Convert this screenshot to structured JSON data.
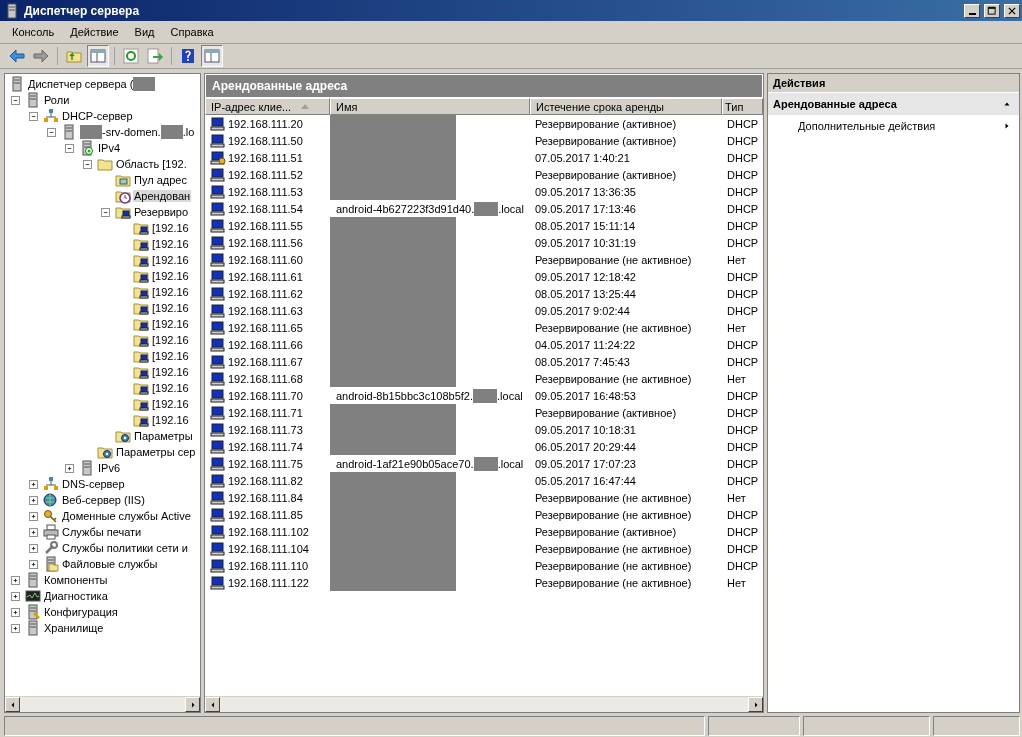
{
  "window": {
    "title": "Диспетчер сервера"
  },
  "menu": [
    "Консоль",
    "Действие",
    "Вид",
    "Справка"
  ],
  "toolbar": [
    {
      "kind": "back"
    },
    {
      "kind": "forward"
    },
    {
      "kind": "sep"
    },
    {
      "kind": "up"
    },
    {
      "kind": "tree",
      "selected": true
    },
    {
      "kind": "sep"
    },
    {
      "kind": "refresh"
    },
    {
      "kind": "export"
    },
    {
      "kind": "sep"
    },
    {
      "kind": "help"
    },
    {
      "kind": "actions",
      "selected": true
    }
  ],
  "tree": [
    {
      "kind": "server-manager",
      "parts": [
        {
          "text": "Диспетчер сервера ("
        },
        {
          "kind": "redacted"
        }
      ],
      "selected": false,
      "children": [
        {
          "kind": "roles",
          "parts": [
            {
              "text": "Роли"
            }
          ],
          "expanded": true,
          "selected": false,
          "children": [
            {
              "kind": "dhcp",
              "parts": [
                {
                  "text": "DHCP-сервер"
                }
              ],
              "expanded": true,
              "selected": false,
              "children": [
                {
                  "kind": "server",
                  "parts": [
                    {
                      "kind": "redacted"
                    },
                    {
                      "text": "-srv-domen."
                    },
                    {
                      "kind": "redacted"
                    },
                    {
                      "text": ".lo"
                    }
                  ],
                  "expanded": true,
                  "selected": false,
                  "children": [
                    {
                      "kind": "ipv4",
                      "parts": [
                        {
                          "text": "IPv4"
                        }
                      ],
                      "expanded": true,
                      "selected": false,
                      "children": [
                        {
                          "kind": "folder",
                          "parts": [
                            {
                              "text": "Область [192."
                            }
                          ],
                          "expanded": true,
                          "selected": false,
                          "children": [
                            {
                              "kind": "pool",
                              "parts": [
                                {
                                  "text": "Пул адрес"
                                }
                              ],
                              "selected": false
                            },
                            {
                              "kind": "lease",
                              "parts": [
                                {
                                  "text": "Арендован"
                                }
                              ],
                              "selected": true
                            },
                            {
                              "kind": "reservations",
                              "parts": [
                                {
                                  "text": "Резервиро"
                                }
                              ],
                              "expanded": true,
                              "selected": false,
                              "children": [
                                {
                                  "kind": "reservation",
                                  "parts": [
                                    {
                                      "text": "[192.16"
                                    }
                                  ],
                                  "selected": false
                                },
                                {
                                  "kind": "reservation",
                                  "parts": [
                                    {
                                      "text": "[192.16"
                                    }
                                  ],
                                  "selected": false
                                },
                                {
                                  "kind": "reservation",
                                  "parts": [
                                    {
                                      "text": "[192.16"
                                    }
                                  ],
                                  "selected": false
                                },
                                {
                                  "kind": "reservation",
                                  "parts": [
                                    {
                                      "text": "[192.16"
                                    }
                                  ],
                                  "selected": false
                                },
                                {
                                  "kind": "reservation",
                                  "parts": [
                                    {
                                      "text": "[192.16"
                                    }
                                  ],
                                  "selected": false
                                },
                                {
                                  "kind": "reservation",
                                  "parts": [
                                    {
                                      "text": "[192.16"
                                    }
                                  ],
                                  "selected": false
                                },
                                {
                                  "kind": "reservation",
                                  "parts": [
                                    {
                                      "text": "[192.16"
                                    }
                                  ],
                                  "selected": false
                                },
                                {
                                  "kind": "reservation",
                                  "parts": [
                                    {
                                      "text": "[192.16"
                                    }
                                  ],
                                  "selected": false
                                },
                                {
                                  "kind": "reservation",
                                  "parts": [
                                    {
                                      "text": "[192.16"
                                    }
                                  ],
                                  "selected": false
                                },
                                {
                                  "kind": "reservation",
                                  "parts": [
                                    {
                                      "text": "[192.16"
                                    }
                                  ],
                                  "selected": false
                                },
                                {
                                  "kind": "reservation",
                                  "parts": [
                                    {
                                      "text": "[192.16"
                                    }
                                  ],
                                  "selected": false
                                },
                                {
                                  "kind": "reservation",
                                  "parts": [
                                    {
                                      "text": "[192.16"
                                    }
                                  ],
                                  "selected": false
                                },
                                {
                                  "kind": "reservation",
                                  "parts": [
                                    {
                                      "text": "[192.16"
                                    }
                                  ],
                                  "selected": false
                                }
                              ]
                            },
                            {
                              "kind": "options",
                              "parts": [
                                {
                                  "text": "Параметры"
                                }
                              ],
                              "selected": false
                            }
                          ]
                        },
                        {
                          "kind": "options-folder",
                          "parts": [
                            {
                              "text": "Параметры сер"
                            }
                          ],
                          "selected": false
                        }
                      ]
                    },
                    {
                      "kind": "ipv6",
                      "parts": [
                        {
                          "text": "IPv6"
                        }
                      ],
                      "expanded": false,
                      "selected": false
                    }
                  ]
                }
              ]
            },
            {
              "kind": "dns",
              "parts": [
                {
                  "text": "DNS-сервер"
                }
              ],
              "expanded": false,
              "selected": false
            },
            {
              "kind": "web",
              "parts": [
                {
                  "text": "Веб-сервер (IIS)"
                }
              ],
              "expanded": false,
              "selected": false
            },
            {
              "kind": "ad",
              "parts": [
                {
                  "text": "Доменные службы Active"
                }
              ],
              "expanded": false,
              "selected": false
            },
            {
              "kind": "print",
              "parts": [
                {
                  "text": "Службы печати"
                }
              ],
              "expanded": false,
              "selected": false
            },
            {
              "kind": "nps",
              "parts": [
                {
                  "text": "Службы политики сети и"
                }
              ],
              "expanded": false,
              "selected": false
            },
            {
              "kind": "files",
              "parts": [
                {
                  "text": "Файловые службы"
                }
              ],
              "expanded": false,
              "selected": false
            }
          ]
        },
        {
          "kind": "features",
          "parts": [
            {
              "text": "Компоненты"
            }
          ],
          "expanded": false,
          "selected": false
        },
        {
          "kind": "diagnostics",
          "parts": [
            {
              "text": "Диагностика"
            }
          ],
          "expanded": false,
          "selected": false
        },
        {
          "kind": "config",
          "parts": [
            {
              "text": "Конфигурация"
            }
          ],
          "expanded": false,
          "selected": false
        },
        {
          "kind": "storage",
          "parts": [
            {
              "text": "Хранилище"
            }
          ],
          "expanded": false,
          "selected": false
        }
      ]
    }
  ],
  "center": {
    "title": "Арендованные адреса",
    "columns": [
      {
        "label": "IP-адрес клие...",
        "sort_ascending": true
      },
      {
        "label": "Имя"
      },
      {
        "label": "Истечение срока аренды"
      },
      {
        "label": "Тип"
      }
    ],
    "rows": [
      {
        "kind": "computer",
        "ip": "192.168.111.20",
        "name_hidden": true,
        "expiry": "Резервирование (активное)",
        "type": "DHCP"
      },
      {
        "kind": "computer",
        "ip": "192.168.111.50",
        "name_hidden": true,
        "expiry": "Резервирование (активное)",
        "type": "DHCP"
      },
      {
        "kind": "computer-badge",
        "ip": "192.168.111.51",
        "name_hidden": true,
        "expiry": "07.05.2017 1:40:21",
        "type": "DHCP"
      },
      {
        "kind": "computer",
        "ip": "192.168.111.52",
        "name_hidden": true,
        "expiry": "Резервирование (активное)",
        "type": "DHCP"
      },
      {
        "kind": "computer",
        "ip": "192.168.111.53",
        "name_hidden": true,
        "expiry": "09.05.2017 13:36:35",
        "type": "DHCP"
      },
      {
        "kind": "computer",
        "ip": "192.168.111.54",
        "name_hidden": false,
        "name_parts": [
          "android-4b627223f3d91d40.",
          ".local"
        ],
        "expiry": "09.05.2017 17:13:46",
        "type": "DHCP"
      },
      {
        "kind": "computer",
        "ip": "192.168.111.55",
        "name_hidden": true,
        "expiry": "08.05.2017 15:11:14",
        "type": "DHCP"
      },
      {
        "kind": "computer",
        "ip": "192.168.111.56",
        "name_hidden": true,
        "expiry": "09.05.2017 10:31:19",
        "type": "DHCP"
      },
      {
        "kind": "computer",
        "ip": "192.168.111.60",
        "name_hidden": true,
        "expiry": "Резервирование (не активное)",
        "type": "Нет"
      },
      {
        "kind": "computer",
        "ip": "192.168.111.61",
        "name_hidden": true,
        "expiry": "09.05.2017 12:18:42",
        "type": "DHCP"
      },
      {
        "kind": "computer",
        "ip": "192.168.111.62",
        "name_hidden": true,
        "expiry": "08.05.2017 13:25:44",
        "type": "DHCP"
      },
      {
        "kind": "computer",
        "ip": "192.168.111.63",
        "name_hidden": true,
        "expiry": "09.05.2017 9:02:44",
        "type": "DHCP"
      },
      {
        "kind": "computer",
        "ip": "192.168.111.65",
        "name_hidden": true,
        "expiry": "Резервирование (не активное)",
        "type": "Нет"
      },
      {
        "kind": "computer",
        "ip": "192.168.111.66",
        "name_hidden": true,
        "expiry": "04.05.2017 11:24:22",
        "type": "DHCP"
      },
      {
        "kind": "computer",
        "ip": "192.168.111.67",
        "name_hidden": true,
        "expiry": "08.05.2017 7:45:43",
        "type": "DHCP"
      },
      {
        "kind": "computer",
        "ip": "192.168.111.68",
        "name_hidden": true,
        "expiry": "Резервирование (не активное)",
        "type": "Нет"
      },
      {
        "kind": "computer",
        "ip": "192.168.111.70",
        "name_hidden": false,
        "name_parts": [
          "android-8b15bbc3c108b5f2.",
          ".local"
        ],
        "expiry": "09.05.2017 16:48:53",
        "type": "DHCP"
      },
      {
        "kind": "computer",
        "ip": "192.168.111.71",
        "name_hidden": true,
        "expiry": "Резервирование (активное)",
        "type": "DHCP"
      },
      {
        "kind": "computer",
        "ip": "192.168.111.73",
        "name_hidden": true,
        "expiry": "09.05.2017 10:18:31",
        "type": "DHCP"
      },
      {
        "kind": "computer",
        "ip": "192.168.111.74",
        "name_hidden": true,
        "expiry": "06.05.2017 20:29:44",
        "type": "DHCP"
      },
      {
        "kind": "computer",
        "ip": "192.168.111.75",
        "name_hidden": false,
        "name_parts": [
          "android-1af21e90b05ace70.",
          ".local"
        ],
        "expiry": "09.05.2017 17:07:23",
        "type": "DHCP"
      },
      {
        "kind": "computer",
        "ip": "192.168.111.82",
        "name_hidden": true,
        "expiry": "05.05.2017 16:47:44",
        "type": "DHCP"
      },
      {
        "kind": "computer",
        "ip": "192.168.111.84",
        "name_hidden": true,
        "expiry": "Резервирование (не активное)",
        "type": "Нет"
      },
      {
        "kind": "computer",
        "ip": "192.168.111.85",
        "name_hidden": true,
        "expiry": "Резервирование (не активное)",
        "type": "DHCP"
      },
      {
        "kind": "computer",
        "ip": "192.168.111.102",
        "name_hidden": true,
        "expiry": "Резервирование (активное)",
        "type": "DHCP"
      },
      {
        "kind": "computer",
        "ip": "192.168.111.104",
        "name_hidden": true,
        "expiry": "Резервирование (не активное)",
        "type": "DHCP"
      },
      {
        "kind": "computer",
        "ip": "192.168.111.110",
        "name_hidden": true,
        "expiry": "Резервирование (не активное)",
        "type": "DHCP"
      },
      {
        "kind": "computer",
        "ip": "192.168.111.122",
        "name_hidden": true,
        "expiry": "Резервирование (не активное)",
        "type": "Нет"
      }
    ]
  },
  "actions": {
    "title": "Действия",
    "section": {
      "title": "Арендованные адреса",
      "expanded": true
    },
    "items": [
      {
        "label": "Дополнительные действия"
      }
    ]
  }
}
